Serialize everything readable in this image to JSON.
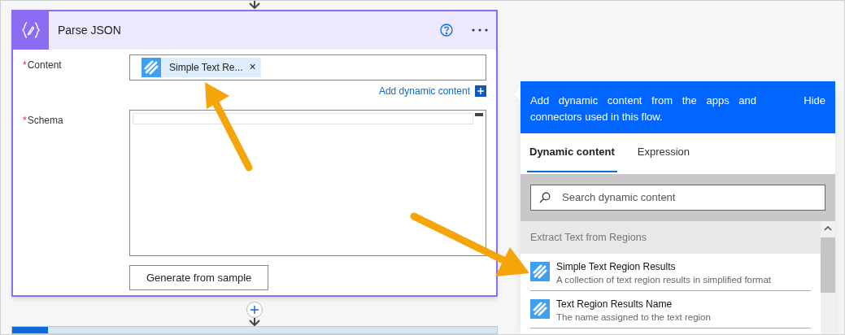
{
  "card": {
    "title": "Parse JSON",
    "fields": [
      {
        "kind": "token",
        "marker": "*",
        "label": "Content",
        "token": "Simple Text Re...",
        "remove": "×"
      },
      {
        "kind": "textarea",
        "marker": "*",
        "label": "Schema"
      }
    ],
    "add_dynamic": "Add dynamic content",
    "button": "Generate from sample"
  },
  "panel": {
    "intro": "Add dynamic content from the apps and connectors used in this flow.",
    "hide": "Hide",
    "tabs": [
      {
        "label": "Dynamic content",
        "selected": true
      },
      {
        "label": "Expression",
        "selected": false
      }
    ],
    "search": {
      "placeholder": "Search dynamic content"
    },
    "section": "Extract Text from Regions",
    "items": [
      {
        "title": "Simple Text Region Results",
        "description": "A collection of text region results in simplified format"
      },
      {
        "title": "Text Region Results Name",
        "description": "The name assigned to the text region"
      }
    ]
  }
}
